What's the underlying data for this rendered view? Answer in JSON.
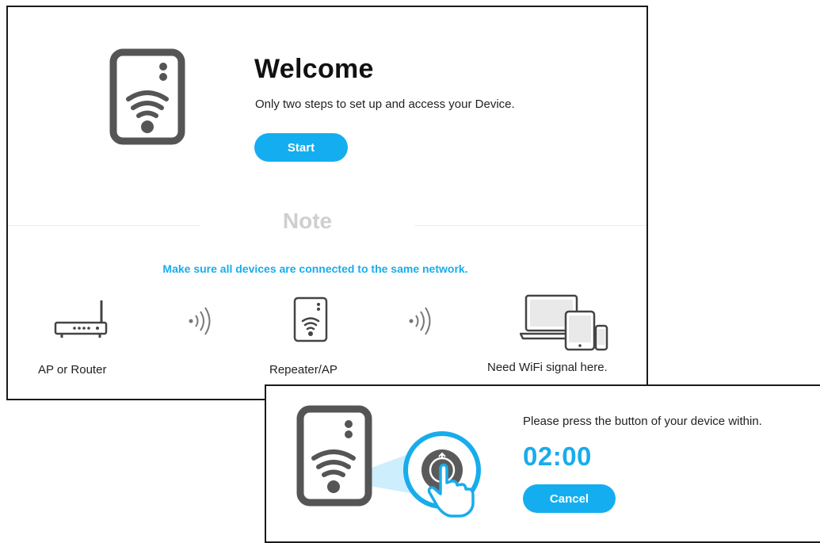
{
  "welcome": {
    "title": "Welcome",
    "subtitle": "Only two steps to set up and access your Device.",
    "start_label": "Start"
  },
  "note": {
    "title": "Note",
    "message": "Make sure all devices are connected to the same network.",
    "items": [
      {
        "label": "AP or Router",
        "icon": "router-icon"
      },
      {
        "label": "Repeater/AP",
        "icon": "repeater-icon"
      },
      {
        "label": "Need WiFi signal here.",
        "icon": "laptop-tablet-phone-icon"
      }
    ]
  },
  "wps": {
    "message": "Please press the button of your device within.",
    "countdown": "02:00",
    "cancel_label": "Cancel"
  },
  "colors": {
    "accent": "#14aef0",
    "note_title": "#cfcfcf",
    "icon_stroke": "#555555"
  }
}
